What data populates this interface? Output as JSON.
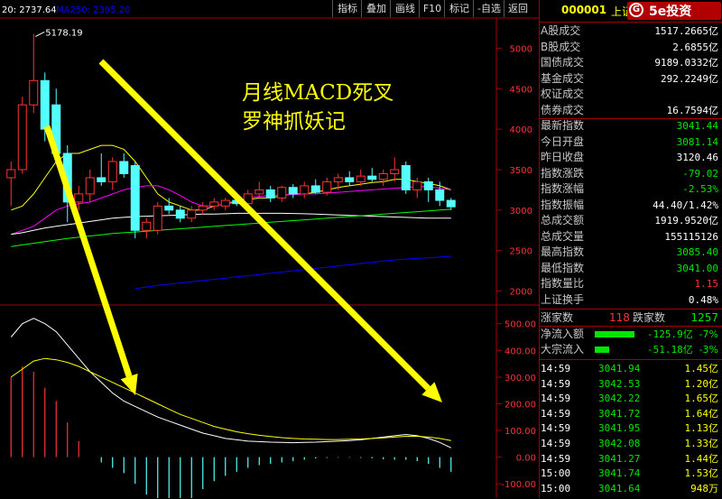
{
  "toolbar": {
    "items": [
      "指标",
      "叠加",
      "画线",
      "F10",
      "标记",
      "-自选",
      "返回"
    ]
  },
  "header": {
    "ma_info": "20: 2737.64",
    "ma250_label": "MA250: 2395.20",
    "high_label": "5178.19",
    "code": "000001",
    "name": "上证指数",
    "logo_text": "5e投资"
  },
  "overlay_text": {
    "line1": "月线MACD死叉",
    "line2": "罗神抓妖记"
  },
  "colors": {
    "up": "#ff3232",
    "down": "#54ffff",
    "ma_white": "#ffffff",
    "ma_yellow": "#ffff00",
    "ma_magenta": "#ff00ff",
    "ma_green": "#00ff00",
    "ma_blue": "#0000ff",
    "arrow": "#ffff00",
    "value_red": "#ff3232",
    "value_green": "#00e600"
  },
  "chart_data": [
    {
      "type": "candlestick",
      "title": "",
      "y_ticks": [
        5000,
        4500,
        4000,
        3500,
        3000,
        2500,
        2000
      ],
      "ylim": [
        1850,
        5350
      ],
      "candles": [
        {
          "o": 3400,
          "h": 3600,
          "l": 3050,
          "c": 3500
        },
        {
          "o": 3500,
          "h": 4400,
          "l": 3450,
          "c": 4300
        },
        {
          "o": 4300,
          "h": 5178,
          "l": 4200,
          "c": 4600
        },
        {
          "o": 4600,
          "h": 4700,
          "l": 3850,
          "c": 4000
        },
        {
          "o": 4300,
          "h": 4500,
          "l": 3600,
          "c": 3700
        },
        {
          "o": 3700,
          "h": 3800,
          "l": 2850,
          "c": 3100
        },
        {
          "o": 3100,
          "h": 3300,
          "l": 3000,
          "c": 3200
        },
        {
          "o": 3200,
          "h": 3500,
          "l": 3100,
          "c": 3400
        },
        {
          "o": 3400,
          "h": 3700,
          "l": 3300,
          "c": 3350
        },
        {
          "o": 3350,
          "h": 3650,
          "l": 3250,
          "c": 3600
        },
        {
          "o": 3600,
          "h": 3700,
          "l": 3400,
          "c": 3450
        },
        {
          "o": 3550,
          "h": 3600,
          "l": 2650,
          "c": 2750
        },
        {
          "o": 2750,
          "h": 2900,
          "l": 2650,
          "c": 2850
        },
        {
          "o": 2750,
          "h": 3100,
          "l": 2700,
          "c": 3050
        },
        {
          "o": 3050,
          "h": 3150,
          "l": 2950,
          "c": 3000
        },
        {
          "o": 3000,
          "h": 3050,
          "l": 2850,
          "c": 2900
        },
        {
          "o": 2900,
          "h": 3050,
          "l": 2850,
          "c": 3000
        },
        {
          "o": 3000,
          "h": 3100,
          "l": 2950,
          "c": 3050
        },
        {
          "o": 3050,
          "h": 3150,
          "l": 3000,
          "c": 3100
        },
        {
          "o": 3050,
          "h": 3150,
          "l": 3000,
          "c": 3120
        },
        {
          "o": 3120,
          "h": 3200,
          "l": 3050,
          "c": 3080
        },
        {
          "o": 3080,
          "h": 3250,
          "l": 3050,
          "c": 3200
        },
        {
          "o": 3200,
          "h": 3350,
          "l": 3150,
          "c": 3250
        },
        {
          "o": 3250,
          "h": 3300,
          "l": 3100,
          "c": 3150
        },
        {
          "o": 3150,
          "h": 3300,
          "l": 3100,
          "c": 3280
        },
        {
          "o": 3280,
          "h": 3320,
          "l": 3150,
          "c": 3200
        },
        {
          "o": 3200,
          "h": 3350,
          "l": 3150,
          "c": 3300
        },
        {
          "o": 3300,
          "h": 3380,
          "l": 3200,
          "c": 3220
        },
        {
          "o": 3220,
          "h": 3400,
          "l": 3180,
          "c": 3350
        },
        {
          "o": 3350,
          "h": 3450,
          "l": 3250,
          "c": 3400
        },
        {
          "o": 3400,
          "h": 3480,
          "l": 3300,
          "c": 3350
        },
        {
          "o": 3350,
          "h": 3500,
          "l": 3300,
          "c": 3420
        },
        {
          "o": 3420,
          "h": 3520,
          "l": 3350,
          "c": 3380
        },
        {
          "o": 3380,
          "h": 3500,
          "l": 3300,
          "c": 3450
        },
        {
          "o": 3450,
          "h": 3650,
          "l": 3350,
          "c": 3500
        },
        {
          "o": 3550,
          "h": 3600,
          "l": 3200,
          "c": 3250
        },
        {
          "o": 3250,
          "h": 3400,
          "l": 3150,
          "c": 3350
        },
        {
          "o": 3350,
          "h": 3400,
          "l": 3100,
          "c": 3250
        },
        {
          "o": 3250,
          "h": 3350,
          "l": 3050,
          "c": 3120
        },
        {
          "o": 3120,
          "h": 3150,
          "l": 3000,
          "c": 3041
        }
      ],
      "ma_lines": [
        {
          "color": "ma_yellow",
          "values": [
            3000,
            3050,
            3200,
            3400,
            3600,
            3700,
            3700,
            3750,
            3800,
            3800,
            3750,
            3600,
            3400,
            3200,
            3100,
            3050,
            3000,
            3000,
            3050,
            3080,
            3100,
            3130,
            3150,
            3150,
            3180,
            3200,
            3200,
            3220,
            3250,
            3280,
            3300,
            3320,
            3340,
            3350,
            3380,
            3380,
            3350,
            3330,
            3300,
            3250
          ]
        },
        {
          "color": "ma_magenta",
          "values": [
            2700,
            2750,
            2800,
            2900,
            3000,
            3050,
            3080,
            3100,
            3150,
            3200,
            3250,
            3280,
            3300,
            3300,
            3250,
            3180,
            3100,
            3050,
            3050,
            3080,
            3120,
            3150,
            3170,
            3180,
            3190,
            3190,
            3200,
            3200,
            3210,
            3220,
            3230,
            3240,
            3250,
            3260,
            3270,
            3280,
            3290,
            3290,
            3270,
            3250
          ]
        },
        {
          "color": "ma_white",
          "values": [
            2700,
            2720,
            2750,
            2780,
            2800,
            2820,
            2840,
            2860,
            2880,
            2900,
            2910,
            2920,
            2925,
            2930,
            2935,
            2940,
            2945,
            2950,
            2950,
            2955,
            2960,
            2960,
            2960,
            2960,
            2960,
            2958,
            2955,
            2950,
            2945,
            2940,
            2935,
            2930,
            2925,
            2920,
            2915,
            2910,
            2905,
            2900,
            2900,
            2900
          ]
        },
        {
          "color": "ma_green",
          "values": [
            2550,
            2570,
            2590,
            2610,
            2630,
            2650,
            2665,
            2680,
            2695,
            2710,
            2720,
            2730,
            2740,
            2750,
            2760,
            2770,
            2780,
            2790,
            2800,
            2810,
            2820,
            2830,
            2840,
            2850,
            2860,
            2870,
            2880,
            2890,
            2900,
            2910,
            2920,
            2930,
            2940,
            2950,
            2960,
            2970,
            2980,
            2990,
            3000,
            3010
          ]
        },
        {
          "color": "ma_blue",
          "values": [
            null,
            null,
            null,
            null,
            null,
            null,
            null,
            null,
            null,
            null,
            null,
            2030,
            2050,
            2070,
            2085,
            2100,
            2115,
            2130,
            2145,
            2160,
            2175,
            2190,
            2205,
            2220,
            2235,
            2250,
            2265,
            2280,
            2295,
            2310,
            2325,
            2340,
            2355,
            2370,
            2385,
            2395,
            2405,
            2410,
            2420,
            2430
          ]
        }
      ]
    },
    {
      "type": "macd",
      "title": "",
      "y_ticks": [
        500,
        400,
        300,
        200,
        100,
        0,
        -100
      ],
      "tick_labels": [
        "500.00",
        "400.00",
        "300.00",
        "200.00",
        "100.00",
        "0.00",
        "-100.00"
      ],
      "ylim": [
        -140,
        560
      ],
      "dif": [
        450,
        500,
        520,
        500,
        470,
        420,
        370,
        320,
        280,
        240,
        210,
        190,
        170,
        150,
        135,
        120,
        105,
        90,
        80,
        70,
        65,
        60,
        58,
        56,
        55,
        54,
        55,
        56,
        58,
        60,
        62,
        65,
        70,
        75,
        80,
        85,
        80,
        70,
        55,
        35
      ],
      "dea": [
        300,
        330,
        360,
        370,
        365,
        355,
        340,
        320,
        300,
        280,
        260,
        240,
        220,
        200,
        180,
        160,
        145,
        130,
        115,
        105,
        95,
        88,
        82,
        77,
        73,
        70,
        68,
        67,
        66,
        66,
        67,
        68,
        70,
        72,
        75,
        78,
        78,
        75,
        70,
        62
      ],
      "hist": [
        300,
        340,
        320,
        260,
        210,
        130,
        60,
        0,
        -20,
        -40,
        -60,
        -100,
        -140,
        -190,
        -210,
        -205,
        -160,
        -120,
        -90,
        -70,
        -55,
        -40,
        -30,
        -25,
        -20,
        -15,
        -10,
        -5,
        -3,
        -2,
        -2,
        -3,
        -5,
        -8,
        -10,
        -10,
        -15,
        -25,
        -40,
        -55
      ]
    }
  ],
  "stats": [
    {
      "label": "A股成交",
      "value": "1517.2665亿",
      "color": "#ffffff"
    },
    {
      "label": "B股成交",
      "value": "2.6855亿",
      "color": "#ffffff"
    },
    {
      "label": "国债成交",
      "value": "9189.0332亿",
      "color": "#ffffff"
    },
    {
      "label": "基金成交",
      "value": "292.2249亿",
      "color": "#ffffff"
    },
    {
      "label": "权证成交",
      "value": "",
      "color": "#ffffff"
    },
    {
      "label": "债券成交",
      "value": "16.7594亿",
      "color": "#ffffff"
    },
    {
      "label": "最新指数",
      "value": "3041.44",
      "color": "#00e600"
    },
    {
      "label": "今日开盘",
      "value": "3081.14",
      "color": "#00e600"
    },
    {
      "label": "昨日收盘",
      "value": "3120.46",
      "color": "#ffffff"
    },
    {
      "label": "指数涨跌",
      "value": "-79.02",
      "color": "#00e600"
    },
    {
      "label": "指数涨幅",
      "value": "-2.53%",
      "color": "#00e600"
    },
    {
      "label": "指数振幅",
      "value": "44.40/1.42%",
      "color": "#ffffff"
    },
    {
      "label": "总成交额",
      "value": "1919.9520亿",
      "color": "#ffffff"
    },
    {
      "label": "总成交量",
      "value": "155115126",
      "color": "#ffffff"
    },
    {
      "label": "最高指数",
      "value": "3085.40",
      "color": "#00e600"
    },
    {
      "label": "最低指数",
      "value": "3041.00",
      "color": "#00e600"
    },
    {
      "label": "指数量比",
      "value": "1.15",
      "color": "#ff3232"
    },
    {
      "label": "上证换手",
      "value": "0.48%",
      "color": "#ffffff"
    }
  ],
  "breadth": {
    "up_label": "涨家数",
    "up_value": "118",
    "down_label": "跌家数",
    "down_value": "1257"
  },
  "flows": [
    {
      "label": "净流入额",
      "value": "-125.9亿",
      "pct": "-7%",
      "bar_fraction": 0.85
    },
    {
      "label": "大宗流入",
      "value": "-51.18亿",
      "pct": "-3%",
      "bar_fraction": 0.3
    }
  ],
  "ticks": [
    {
      "time": "14:59",
      "price": "3041.94",
      "vol": "1.45亿"
    },
    {
      "time": "14:59",
      "price": "3042.53",
      "vol": "1.20亿"
    },
    {
      "time": "14:59",
      "price": "3042.22",
      "vol": "1.65亿"
    },
    {
      "time": "14:59",
      "price": "3041.72",
      "vol": "1.64亿"
    },
    {
      "time": "14:59",
      "price": "3041.95",
      "vol": "1.13亿"
    },
    {
      "time": "14:59",
      "price": "3042.08",
      "vol": "1.33亿"
    },
    {
      "time": "14:59",
      "price": "3041.27",
      "vol": "1.44亿"
    },
    {
      "time": "15:00",
      "price": "3041.74",
      "vol": "1.53亿"
    },
    {
      "time": "15:00",
      "price": "3041.64",
      "vol": "948万"
    }
  ]
}
